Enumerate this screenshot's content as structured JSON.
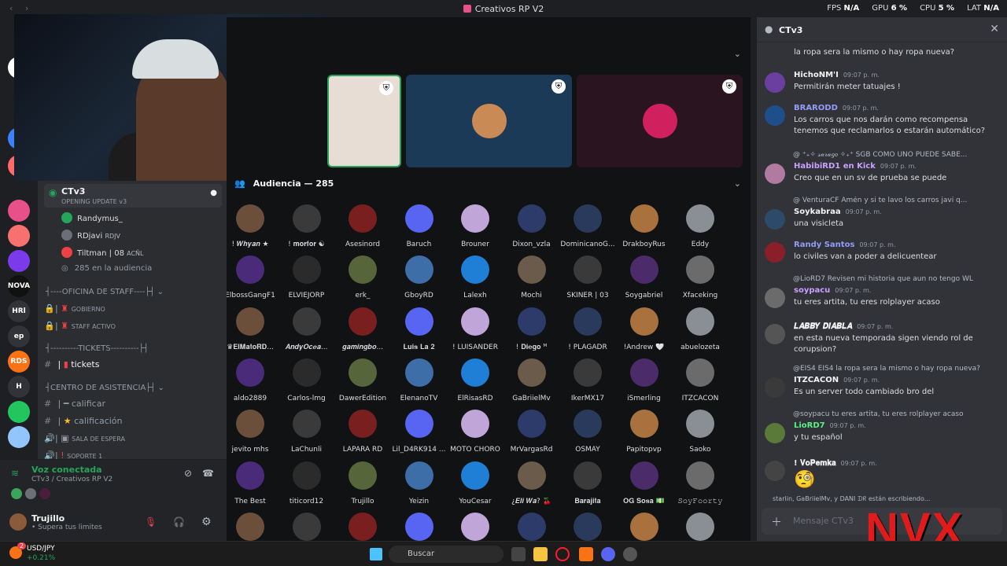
{
  "window": {
    "title": "Creativos RP V2"
  },
  "stats": {
    "fps_label": "FPS",
    "fps": "N/A",
    "gpu_label": "GPU",
    "gpu": "6 %",
    "cpu_label": "CPU",
    "cpu": "5 %",
    "lat_label": "LAT",
    "lat": "N/A"
  },
  "servers": [
    "NOVA",
    "HRl",
    "ep",
    "RDS",
    "H"
  ],
  "channels": {
    "voice_channel": "CTv3",
    "voice_status": "OPENING UPDATE v3",
    "voice_members": [
      {
        "name": "Randymus_",
        "tag": ""
      },
      {
        "name": "RDjavi",
        "tag": "RDJV"
      },
      {
        "name": "Tiltman | 08",
        "tag": "ACÑL"
      }
    ],
    "audience_count": "285 en la audiencia",
    "cat_staff": "----OFICINA DE STAFF----",
    "ch_gobierno": "GOBIERNO",
    "ch_staff": "STAFF ACTIVO",
    "cat_tickets": "----------TICKETS----------",
    "ch_tickets": "tickets",
    "cat_asistencia": "CENTRO DE ASISTENCIA",
    "ch_calificar": "calificar",
    "ch_calificacion": "calificación",
    "ch_sala": "SALA DE ESPERA",
    "ch_soporte": "SOPORTE 1"
  },
  "voice_panel": {
    "status": "Voz conectada",
    "location": "CTv3 / Creativos RP V2",
    "user": "Trujillo",
    "user_status": "• Supera tus limites"
  },
  "stage": {
    "audience_header": "Audiencia — 285",
    "audience": [
      "! 𝑾𝒉𝒚𝒂𝒏 ★",
      "! 𝐦𝐨𝐫𝐟𝐨𝐫 ☯",
      "Asesinord",
      "Baruch",
      "Brouner",
      "Dixon_vzla",
      "DominicanoG...",
      "DrakboyRus",
      "Eddy",
      "ElbossGangF1",
      "ELVIEJORP",
      "erk_",
      "GboyRD",
      "Lalexh",
      "Mochi",
      "SKINER | 03",
      "Soygabriel",
      "Xfaceking",
      "♛𝐄𝐥𝐌𝐚𝐭𝐨𝐑𝐃...",
      "𝑨𝒏𝒅𝒚𝑶𝒄𝒆𝒂...",
      "𝒈𝒂𝒎𝒊𝒏𝒈𝒃𝒐...",
      "𝐋𝐮𝐢𝐬 𝐋𝐚 𝟐",
      "! LUISANDER",
      "! 𝐃𝐢𝐞𝐠𝐨 ᴹ",
      "! PLAGADR",
      "!Andrew 🤍",
      "abuelozeta",
      "aldo2889",
      "Carlos-lmg",
      "DawerEdition",
      "ElenanoTV",
      "ElRisasRD",
      "GaBriielMv",
      "IkerMX17",
      "iSmerling",
      "ITZCACON",
      "jevito mhs",
      "LaChunli",
      "LAPARA RD",
      "Lil_D4RK914 ...",
      "MOTO CHORO",
      "MrVargasRd",
      "OSMAY",
      "Papitopvp",
      "Saoko",
      "The Best",
      "titicord12",
      "Trujillo",
      "Yeizin",
      "YouCesar",
      "¿𝑬𝒍𝒊 𝑾𝒂? 🍒",
      "𝐁𝐚𝐫𝐚𝐣𝐢𝐭𝐚",
      "𝐎𝐆 𝐒𝐨𝐬𝐚 💵",
      "𝚂𝚘𝚢𝙵𝚘𝚘𝚛𝚝𝚢",
      "",
      "",
      "",
      "",
      "",
      "",
      "",
      "",
      ""
    ]
  },
  "chat": {
    "title": "CTv3",
    "messages": [
      {
        "user": "",
        "time": "",
        "text": "la ropa sera la mismo o hay ropa nueva?",
        "reply": "",
        "color": "#f2f3f5"
      },
      {
        "user": "HichoNM'I",
        "time": "09:07 p. m.",
        "text": "Permitirán meter tatuajes !",
        "reply": "",
        "color": "#f2f3f5"
      },
      {
        "user": "BRARODD",
        "time": "09:07 p. m.",
        "text": "Los carros que nos darán como recompensa tenemos que reclamarlos o estarán automático?",
        "reply": "",
        "color": "#949cf7"
      },
      {
        "user": "HabibiRD1 en Kick",
        "time": "09:07 p. m.",
        "text": "Creo que en un sv de prueba se puede",
        "reply": "@ ⁺₊✧ 𝓈𝒶𝓇𝒶𝑔𝑜 ✧₊⁺ SGB COMO UNO PUEDE SABE...",
        "color": "#c9a0ff"
      },
      {
        "user": "Soykabraa",
        "time": "09:07 p. m.",
        "text": "una visicleta",
        "reply": "@ VenturaCF Amén y si te lavo los carros javi q...",
        "color": "#f2f3f5"
      },
      {
        "user": "Randy Santos",
        "time": "09:07 p. m.",
        "text": "lo civiles van a poder a delicuentear",
        "reply": "",
        "color": "#949cf7"
      },
      {
        "user": "soypacu",
        "time": "09:07 p. m.",
        "text": "tu eres artita, tu eres rolplayer acaso",
        "reply": "@LioRD7 Revisen mi historia que aun no tengo WL",
        "color": "#c9a0ff"
      },
      {
        "user": "𝑳𝑨𝑩𝑩𝒀 𝑫𝑰𝑨𝑩𝑳𝑨",
        "time": "09:07 p. m.",
        "text": "en esta nueva temporada sigen viendo rol de corupsion?",
        "reply": "",
        "color": "#f2f3f5"
      },
      {
        "user": "ITZCACON",
        "time": "09:07 p. m.",
        "text": "Es un server todo cambiado bro del",
        "reply": "@EIS4 EIS4 la ropa sera la mismo o hay ropa nueva?",
        "color": "#f2f3f5"
      },
      {
        "user": "LioRD7",
        "time": "09:07 p. m.",
        "text": "y tu español",
        "reply": "@soypacu tu eres artita, tu eres rolplayer acaso",
        "color": "#57f287"
      },
      {
        "user": "! 𝐕𝐨𝐏𝐞𝐦𝐤𝐚",
        "time": "09:07 p. m.",
        "text": "🧐",
        "reply": "",
        "color": "#f2f3f5"
      }
    ],
    "typing": "starlin, GaBriielMv, y DANI ᗪᖇ están escribiendo...",
    "placeholder": "Mensaje CTv3"
  },
  "overlay": {
    "logo": "NVX"
  },
  "taskbar": {
    "ticker": "USD/JPY",
    "change": "+0.21%",
    "badge": "2",
    "search": "Buscar"
  },
  "colors": {
    "accent": "#5865f2",
    "online": "#23a55a",
    "danger": "#e01b1b"
  }
}
